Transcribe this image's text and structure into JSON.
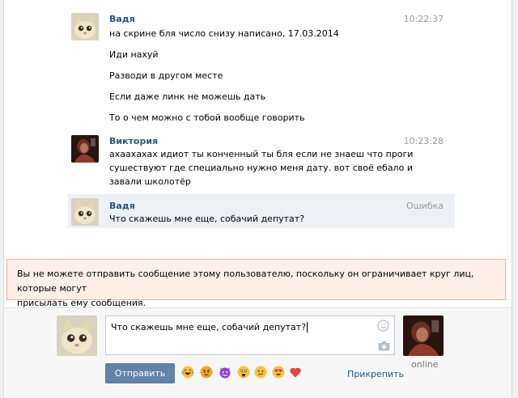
{
  "messages": [
    {
      "author": "Вадя",
      "time": "10:22:37",
      "lines": [
        "на скрине бля число снизу написано, 17.03.2014",
        "Иди нахуй",
        "Разводи в другом месте",
        "Если даже линк не можешь дать",
        "То о чем можно с тобой вообще говорить"
      ]
    },
    {
      "author": "Виктория",
      "time": "10:23:28",
      "lines": [
        "ахаахахах идиот ты конченный ты бля если не знаеш что проги",
        "сушествуют где специально нужно меня дату. вот своё ебало и",
        "завали школотёр"
      ]
    },
    {
      "author": "Вадя",
      "status": "Ошибка",
      "lines": [
        "Что скажешь мне еще, собачий депутат?"
      ]
    }
  ],
  "warning": {
    "line1": "Вы не можете отправить сообщение этому пользователю, поскольку он ограничивает круг лиц, которые могут",
    "line2": "присылать ему сообщения."
  },
  "composer": {
    "text": "Что скажешь мне еще, собачий депутат?",
    "send_label": "Отправить",
    "attach_label": "Прикрепить",
    "peer_status": "online",
    "emojis": [
      "laughing-emoji",
      "angry-emoji",
      "devil-emoji",
      "screaming-emoji",
      "confused-emoji",
      "heart-eyes-emoji",
      "heart-emoji"
    ]
  },
  "colors": {
    "link": "#2b587a",
    "button": "#6383a8",
    "warning_bg": "#ffefe9",
    "warning_border": "#f2ab99",
    "highlight": "#edf1f5"
  }
}
